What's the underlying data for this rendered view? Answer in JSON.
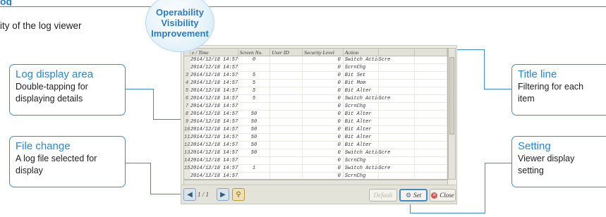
{
  "page": {
    "heading_fragment": "og",
    "intro_fragment": "ity of the log viewer"
  },
  "badge": {
    "line1": "Operability",
    "line2": "Visibility",
    "line3": "Improvement"
  },
  "callouts": {
    "log_display": {
      "title": "Log display area",
      "desc1": "Double-tapping for",
      "desc2": "displaying details"
    },
    "file_change": {
      "title": "File change",
      "desc1": "A log file selected for",
      "desc2": "display"
    },
    "title_line": {
      "title": "Title line",
      "desc1": "Filtering for each",
      "desc2": "item"
    },
    "setting": {
      "title": "Setting",
      "desc1": "Viewer display",
      "desc2": "setting"
    }
  },
  "viewer": {
    "columns": [
      "e / Time",
      "Screen No.",
      "User ID",
      "Security Level",
      "Action",
      ""
    ],
    "rows": [
      {
        "num": "",
        "time": "2014/12/18 14:57",
        "screen": "0",
        "level": "0",
        "action": "Switch Action",
        "extra": "Scre"
      },
      {
        "num": "",
        "time": "2014/12/18 14:57",
        "screen": "",
        "level": "0",
        "action": "ScrnChg",
        "extra": ""
      },
      {
        "num": "3",
        "time": "2014/12/18 14:57",
        "screen": "5",
        "level": "0",
        "action": "Bit Set",
        "extra": ""
      },
      {
        "num": "4",
        "time": "2014/12/18 14:57",
        "screen": "5",
        "level": "0",
        "action": "Bit Mom",
        "extra": ""
      },
      {
        "num": "5",
        "time": "2014/12/18 14:57",
        "screen": "5",
        "level": "0",
        "action": "Bit Alter",
        "extra": ""
      },
      {
        "num": "6",
        "time": "2014/12/18 14:57",
        "screen": "5",
        "level": "0",
        "action": "Switch Action",
        "extra": "Scre"
      },
      {
        "num": "7",
        "time": "2014/12/18 14:57",
        "screen": "",
        "level": "0",
        "action": "ScrnChg",
        "extra": ""
      },
      {
        "num": "8",
        "time": "2014/12/18 14:57",
        "screen": "50",
        "level": "0",
        "action": "Bit Alter",
        "extra": ""
      },
      {
        "num": "9",
        "time": "2014/12/18 14:57",
        "screen": "50",
        "level": "0",
        "action": "Bit Alter",
        "extra": ""
      },
      {
        "num": "10",
        "time": "2014/12/18 14:57",
        "screen": "50",
        "level": "0",
        "action": "Bit Alter",
        "extra": ""
      },
      {
        "num": "11",
        "time": "2014/12/18 14:57",
        "screen": "50",
        "level": "0",
        "action": "Bit Alter",
        "extra": ""
      },
      {
        "num": "12",
        "time": "2014/12/18 14:57",
        "screen": "50",
        "level": "0",
        "action": "Bit Alter",
        "extra": ""
      },
      {
        "num": "13",
        "time": "2014/12/18 14:57",
        "screen": "50",
        "level": "0",
        "action": "Switch Action",
        "extra": "Scre"
      },
      {
        "num": "14",
        "time": "2014/12/18 14:57",
        "screen": "",
        "level": "0",
        "action": "ScrnChg",
        "extra": ""
      },
      {
        "num": "15",
        "time": "2014/12/18 14:57",
        "screen": "1",
        "level": "0",
        "action": "Switch Action",
        "extra": "Scre"
      },
      {
        "num": "",
        "time": "2014/12/18 14:57",
        "screen": "",
        "level": "0",
        "action": "ScrnChg",
        "extra": ""
      }
    ],
    "pager": "1 / 1",
    "default_label": "Default",
    "set_label": "Set",
    "close_label": "Close"
  },
  "icons": [
    "file-prev-icon",
    "file-next-icon",
    "search-icon",
    "settings-icon",
    "close-icon"
  ],
  "colors": {
    "accent": "#3a8ec8",
    "accent_text": "#2a86c8",
    "close": "#d9534f"
  }
}
